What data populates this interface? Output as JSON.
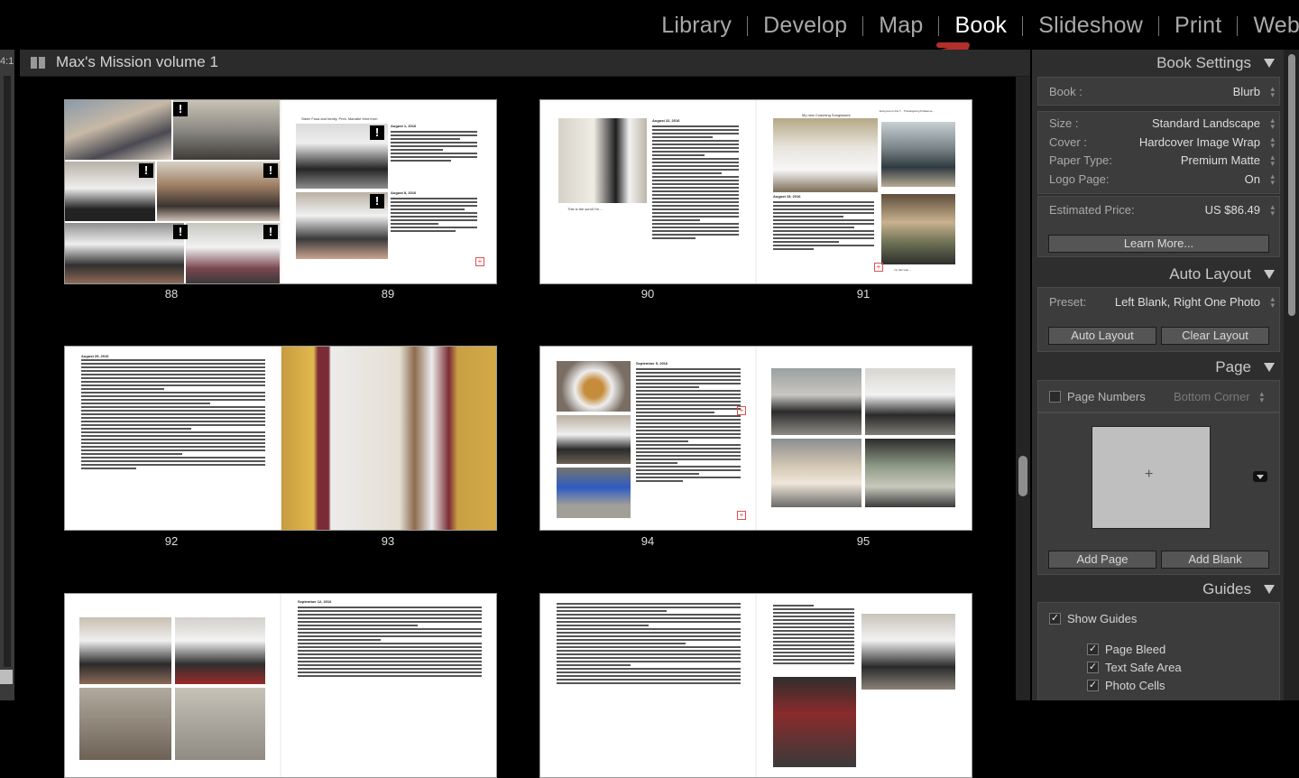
{
  "modules": {
    "items": [
      "Library",
      "Develop",
      "Map",
      "Book",
      "Slideshow",
      "Print",
      "Web"
    ],
    "active": "Book"
  },
  "filmstrip": {
    "zoom_label": "4:1"
  },
  "book": {
    "title": "Max's Mission volume 1"
  },
  "pages": {
    "p88": "88",
    "p89": "89",
    "p90": "90",
    "p91": "91",
    "p92": "92",
    "p93": "93",
    "p94": "94",
    "p95": "95"
  },
  "page_text": {
    "p89_caption": "Sister Fusa and family. Pres. Manabe third from",
    "p90_caption": "This is the scroll I'm ...",
    "p91_caption": "Everyone is this T... Thanksgiving Pollasone...",
    "p91_heading": "My new Coaching Sunglasses",
    "p95_caption": "my hair was ...",
    "date_aug1": "August 1, 2016",
    "date_aug8": "August 8, 2016",
    "date_aug15": "August 15, 2016",
    "date_aug22": "August 22, 2016",
    "date_aug29": "August 29, 2016",
    "date_sep5": "September 5, 2016",
    "date_sep12": "September 12, 2016"
  },
  "book_settings": {
    "header": "Book Settings",
    "book_label": "Book :",
    "book_value": "Blurb",
    "size_label": "Size :",
    "size_value": "Standard Landscape",
    "cover_label": "Cover :",
    "cover_value": "Hardcover Image Wrap",
    "paper_label": "Paper Type:",
    "paper_value": "Premium Matte",
    "logo_label": "Logo Page:",
    "logo_value": "On",
    "price_label": "Estimated Price:",
    "price_value": "US $86.49",
    "learn_more": "Learn More..."
  },
  "auto_layout": {
    "header": "Auto Layout",
    "preset_label": "Preset:",
    "preset_value": "Left Blank, Right One Photo",
    "auto_layout_btn": "Auto Layout",
    "clear_layout_btn": "Clear Layout"
  },
  "page_panel": {
    "header": "Page",
    "page_numbers_label": "Page Numbers",
    "page_numbers_position": "Bottom Corner",
    "add_page": "Add Page",
    "add_blank": "Add Blank",
    "preview_plus": "+"
  },
  "guides": {
    "header": "Guides",
    "show_guides": "Show Guides",
    "page_bleed": "Page Bleed",
    "text_safe_area": "Text Safe Area",
    "photo_cells": "Photo Cells",
    "check": "✓"
  },
  "colors": {
    "accent_arrow": "#b0302c",
    "panel_bg": "#2e2e2e",
    "active_module": "#ffffff",
    "inactive_module": "#a9a9a9"
  }
}
